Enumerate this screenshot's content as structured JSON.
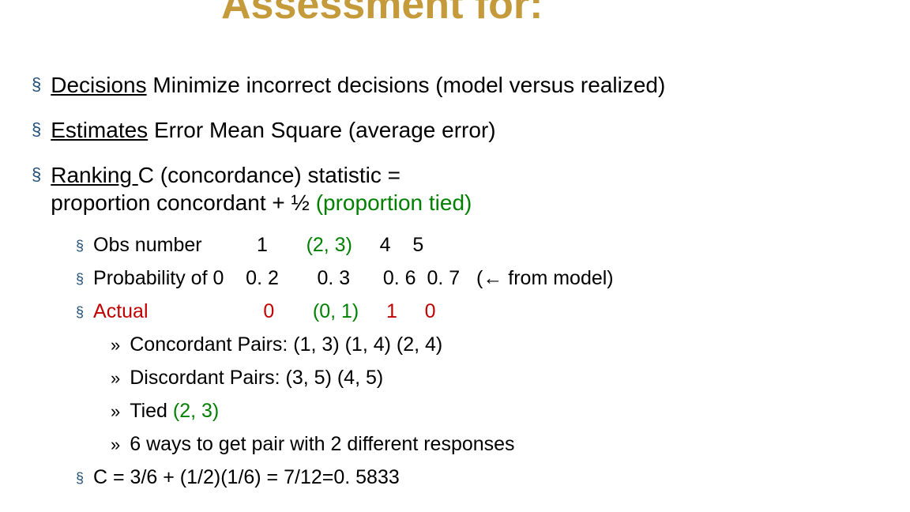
{
  "title": "Assessment for:",
  "b1": {
    "u": "Decisions",
    "rest": "  Minimize incorrect decisions (model versus realized)"
  },
  "b2": {
    "u": "Estimates",
    "rest": "  Error Mean Square (average error)"
  },
  "b3": {
    "u": "Ranking ",
    "rest_a": "C (concordance) statistic =",
    "rest_b": "proportion concordant + ½ ",
    "rest_green": "(proportion  tied)"
  },
  "s1": {
    "label": "Obs number          1       ",
    "g": "(2, 3)",
    "tail": "     4    5"
  },
  "s2": {
    "label": "Probability of 0    0. 2       0. 3      0. 6  0. 7   (",
    "arrow": "←",
    "tail2": " from model)"
  },
  "s3": {
    "label": "Actual                     0       ",
    "g": "(0, 1)",
    "tail": "     1     0"
  },
  "ss1": "Concordant Pairs: (1, 3)  (1, 4)  (2, 4)",
  "ss2": "Discordant  Pairs: (3, 5) (4, 5)",
  "ss3": {
    "pre": "Tied ",
    "g": "(2, 3)"
  },
  "ss4": "6 ways to get pair with 2 different responses",
  "s4": "C = 3/6 + (1/2)(1/6) = 7/12=0. 5833"
}
